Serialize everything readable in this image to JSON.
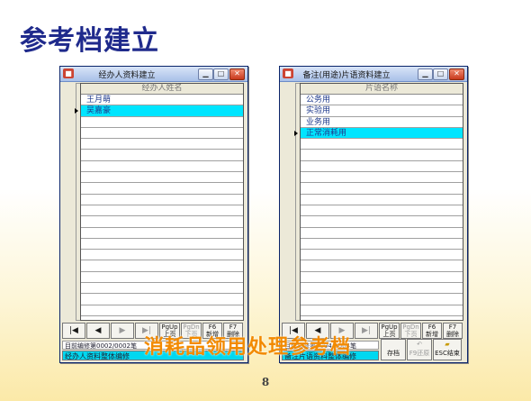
{
  "slide": {
    "title": "参考档建立",
    "page_number": "8",
    "overlay_caption": "消耗品领用处理参考档"
  },
  "left_window": {
    "title": "经办人资料建立",
    "column_header": "经办人姓名",
    "rows": [
      "王月萌",
      "吴嘉豪",
      "",
      "",
      "",
      "",
      "",
      "",
      "",
      "",
      "",
      "",
      "",
      "",
      "",
      "",
      "",
      "",
      "",
      ""
    ],
    "selected_row": 1,
    "nav": {
      "first": "|◀",
      "prev": "◀",
      "next": "▶",
      "last": "▶|",
      "pgup_key": "PgUp",
      "pgup_label": "上页",
      "pgdn_key": "PgDn",
      "pgdn_label": "下页",
      "f6_key": "F6",
      "f6_label": "新增",
      "f7_key": "F7",
      "f7_label": "删除"
    },
    "status_line": "目前编修第0002/0002笔",
    "status_bar": "经办人资料整体编修"
  },
  "right_window": {
    "title": "备注(用途)片语资料建立",
    "column_header": "片语名称",
    "rows": [
      "公务用",
      "实验用",
      "业务用",
      "正常消耗用",
      "",
      "",
      "",
      "",
      "",
      "",
      "",
      "",
      "",
      "",
      "",
      "",
      "",
      "",
      "",
      ""
    ],
    "selected_row": 3,
    "nav": {
      "first": "|◀",
      "prev": "◀",
      "next": "▶",
      "last": "▶|",
      "pgup_key": "PgUp",
      "pgup_label": "上页",
      "pgdn_key": "PgDn",
      "pgdn_label": "下页",
      "f6_key": "F6",
      "f6_label": "新增",
      "f7_key": "F7",
      "f7_label": "删除"
    },
    "status_line": "目前编修第0004/0004笔",
    "status_bar": "备注片语资料整体编修",
    "extra_buttons": {
      "save_label": "存档",
      "restore_key": "F9",
      "restore_label": "还原",
      "exit_key": "ESC",
      "exit_label": "结束"
    }
  },
  "colors": {
    "title": "#1f2a8c",
    "selection": "#00e5ff",
    "overlay": "#f28a00",
    "close": "#c8381c"
  }
}
